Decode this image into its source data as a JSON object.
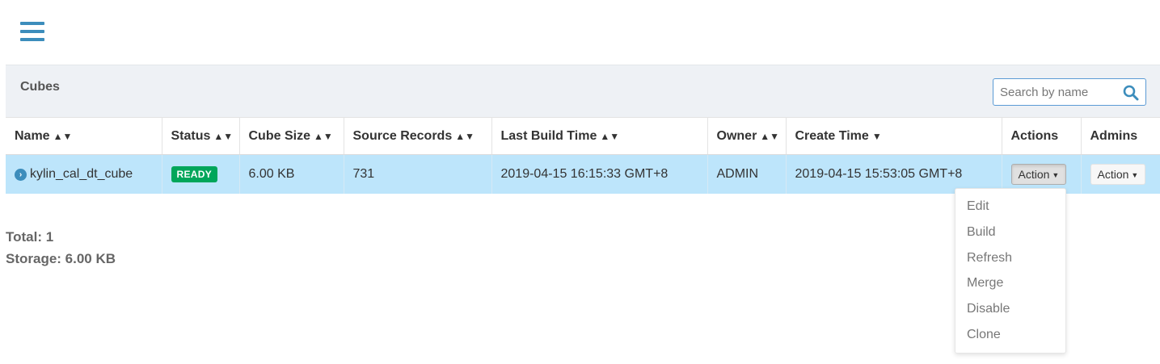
{
  "panel": {
    "title": "Cubes"
  },
  "search": {
    "placeholder": "Search by name"
  },
  "table": {
    "headers": {
      "name": "Name",
      "status": "Status",
      "cube_size": "Cube Size",
      "source_records": "Source Records",
      "last_build_time": "Last Build Time",
      "owner": "Owner",
      "create_time": "Create Time",
      "actions": "Actions",
      "admins": "Admins"
    },
    "rows": [
      {
        "name": "kylin_cal_dt_cube",
        "status": "READY",
        "cube_size": "6.00 KB",
        "source_records": "731",
        "last_build_time": "2019-04-15 16:15:33 GMT+8",
        "owner": "ADMIN",
        "create_time": "2019-04-15 15:53:05 GMT+8",
        "action_label": "Action",
        "admin_action_label": "Action"
      }
    ]
  },
  "dropdown": {
    "items": [
      "Edit",
      "Build",
      "Refresh",
      "Merge",
      "Disable",
      "Clone"
    ]
  },
  "summary": {
    "total": "Total: 1",
    "storage": "Storage: 6.00 KB"
  },
  "colors": {
    "accent": "#3c8dbc",
    "row_highlight": "#bde5fb",
    "ready_badge": "#00a65a",
    "panel_header": "#eef1f5"
  }
}
